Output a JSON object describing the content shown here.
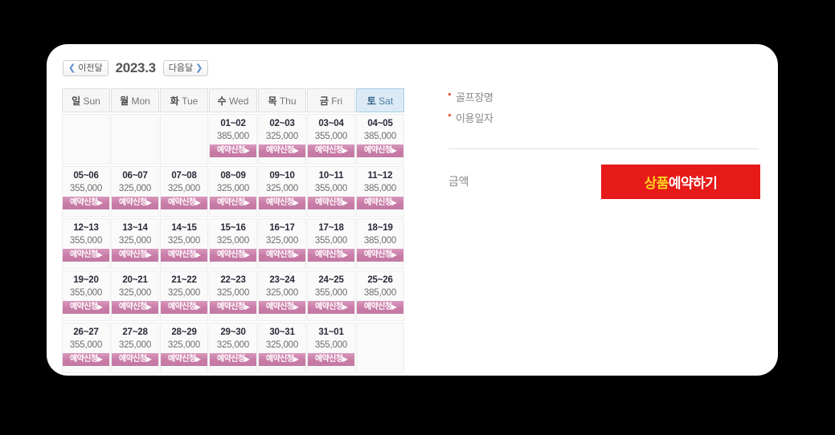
{
  "calendar": {
    "prev_label": "이전달",
    "prev_icon": "chevron-left-icon",
    "next_label": "다음달",
    "next_icon": "chevron-right-icon",
    "title": "2023.3",
    "weekdays": [
      {
        "kr": "일",
        "en": "Sun",
        "highlight": false
      },
      {
        "kr": "월",
        "en": "Mon",
        "highlight": false
      },
      {
        "kr": "화",
        "en": "Tue",
        "highlight": false
      },
      {
        "kr": "수",
        "en": "Wed",
        "highlight": false
      },
      {
        "kr": "목",
        "en": "Thu",
        "highlight": false
      },
      {
        "kr": "금",
        "en": "Fri",
        "highlight": false
      },
      {
        "kr": "토",
        "en": "Sat",
        "highlight": true
      }
    ],
    "book_label": "예약신청",
    "book_arrow": "▶",
    "weeks": [
      [
        {
          "empty": true
        },
        {
          "empty": true
        },
        {
          "empty": true
        },
        {
          "range": "01~02",
          "price": "385,000"
        },
        {
          "range": "02~03",
          "price": "325,000"
        },
        {
          "range": "03~04",
          "price": "355,000"
        },
        {
          "range": "04~05",
          "price": "385,000"
        }
      ],
      [
        {
          "range": "05~06",
          "price": "355,000"
        },
        {
          "range": "06~07",
          "price": "325,000"
        },
        {
          "range": "07~08",
          "price": "325,000"
        },
        {
          "range": "08~09",
          "price": "325,000"
        },
        {
          "range": "09~10",
          "price": "325,000"
        },
        {
          "range": "10~11",
          "price": "355,000"
        },
        {
          "range": "11~12",
          "price": "385,000"
        }
      ],
      [
        {
          "range": "12~13",
          "price": "355,000"
        },
        {
          "range": "13~14",
          "price": "325,000"
        },
        {
          "range": "14~15",
          "price": "325,000"
        },
        {
          "range": "15~16",
          "price": "325,000"
        },
        {
          "range": "16~17",
          "price": "325,000"
        },
        {
          "range": "17~18",
          "price": "355,000"
        },
        {
          "range": "18~19",
          "price": "385,000"
        }
      ],
      [
        {
          "range": "19~20",
          "price": "355,000"
        },
        {
          "range": "20~21",
          "price": "325,000"
        },
        {
          "range": "21~22",
          "price": "325,000"
        },
        {
          "range": "22~23",
          "price": "325,000"
        },
        {
          "range": "23~24",
          "price": "325,000"
        },
        {
          "range": "24~25",
          "price": "355,000"
        },
        {
          "range": "25~26",
          "price": "385,000"
        }
      ],
      [
        {
          "range": "26~27",
          "price": "355,000"
        },
        {
          "range": "27~28",
          "price": "325,000"
        },
        {
          "range": "28~29",
          "price": "325,000"
        },
        {
          "range": "29~30",
          "price": "325,000"
        },
        {
          "range": "30~31",
          "price": "325,000"
        },
        {
          "range": "31~01",
          "price": "355,000"
        },
        {
          "empty": true
        }
      ]
    ]
  },
  "panel": {
    "info_rows": [
      {
        "label": "골프장명"
      },
      {
        "label": "이용일자"
      }
    ],
    "amount_label": "금액",
    "amount_value": "",
    "reserve_button": {
      "highlight_text": "상품",
      "rest_text": "예약하기"
    }
  },
  "colors": {
    "page_background": "#000000",
    "card_background": "#ffffff",
    "book_button": "#c87ba6",
    "reserve_button": "#e61a18",
    "reserve_highlight": "#ffd21e",
    "saturday_header": "#dbeaf5",
    "bullet": "#e8603c"
  }
}
